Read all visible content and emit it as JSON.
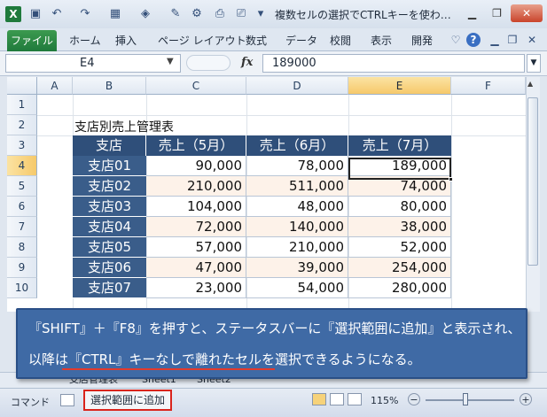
{
  "window": {
    "title": "複数セルの選択でCTRLキーを使わ…",
    "app_icon": "X",
    "quick_access": [
      "save-icon",
      "undo-icon",
      "redo-icon",
      "borders-icon",
      "fill-color-icon",
      "format-painter-icon",
      "print-preview-icon",
      "customize-icon"
    ]
  },
  "ribbon": {
    "file_tab": "ファイル",
    "tabs": [
      "ホーム",
      "挿入",
      "ページ レイアウト",
      "数式",
      "データ",
      "校閲",
      "表示",
      "開発"
    ]
  },
  "formula_bar": {
    "name_box": "E4",
    "fx": "fx",
    "value": "189000"
  },
  "grid": {
    "columns": [
      "A",
      "B",
      "C",
      "D",
      "E",
      "F"
    ],
    "rows": [
      "1",
      "2",
      "3",
      "4",
      "5",
      "6",
      "7",
      "8",
      "9",
      "10"
    ],
    "selected_column": "E",
    "selected_row": "4"
  },
  "table": {
    "title": "支店別売上管理表",
    "headers": [
      "支店",
      "売上（5月）",
      "売上（6月）",
      "売上（7月）"
    ],
    "rows": [
      {
        "branch": "支店01",
        "may": "90,000",
        "jun": "78,000",
        "jul": "189,000"
      },
      {
        "branch": "支店02",
        "may": "210,000",
        "jun": "511,000",
        "jul": "74,000"
      },
      {
        "branch": "支店03",
        "may": "104,000",
        "jun": "48,000",
        "jul": "80,000"
      },
      {
        "branch": "支店04",
        "may": "72,000",
        "jun": "140,000",
        "jul": "38,000"
      },
      {
        "branch": "支店05",
        "may": "57,000",
        "jun": "210,000",
        "jul": "52,000"
      },
      {
        "branch": "支店06",
        "may": "47,000",
        "jun": "39,000",
        "jul": "254,000"
      },
      {
        "branch": "支店07",
        "may": "23,000",
        "jun": "54,000",
        "jul": "280,000"
      }
    ]
  },
  "callout": {
    "line1": "『SHIFT』＋『F8』を押すと、ステータスバーに『選択範囲に追加』と表示され、",
    "line2": "以降は『CTRL』キーなしで離れたセルを選択できるようになる。"
  },
  "sheet_tabs": [
    "支店管理表",
    "Sheet1",
    "Sheet2"
  ],
  "status_bar": {
    "mode": "コマンド",
    "extend_mode": "選択範囲に追加",
    "zoom": "115%",
    "zoom_minus": "−",
    "zoom_plus": "+"
  },
  "colors": {
    "header_fill": "#2f4f7a",
    "branch_fill": "#3a5d8a",
    "alt_row": "#fdf2e9",
    "callout": "#3f6aa5",
    "highlight_border": "#d9241c"
  }
}
